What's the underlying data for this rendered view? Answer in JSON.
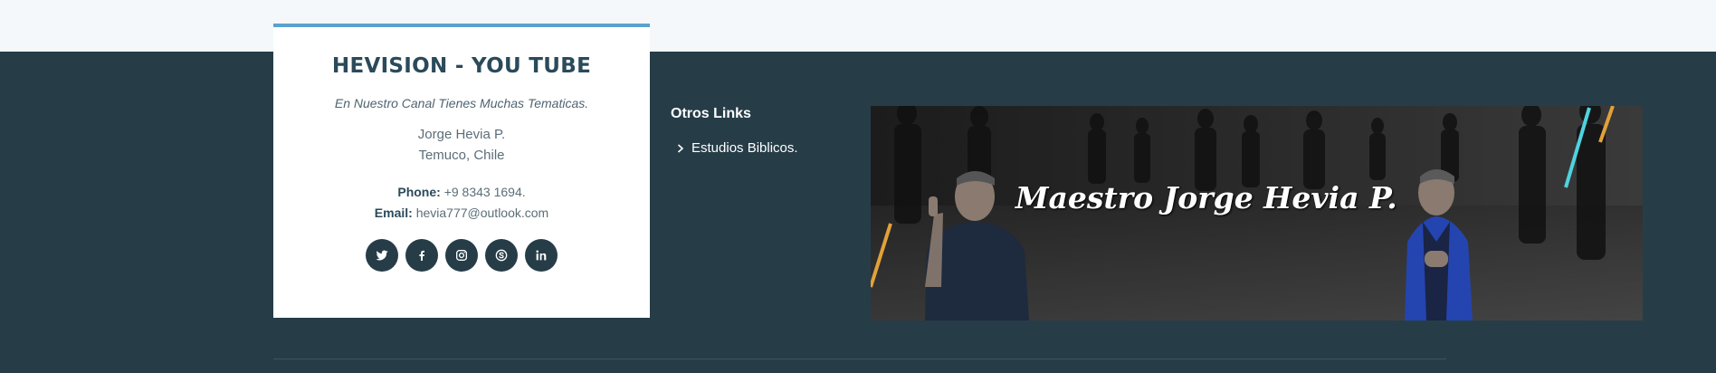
{
  "card": {
    "title": "HEVISION - YOU TUBE",
    "subtitle": "En Nuestro Canal Tienes Muchas Tematicas.",
    "name": "Jorge Hevia P.",
    "city": "Temuco, Chile",
    "phone_label": "Phone:",
    "phone_value": "+9 8343 1694.",
    "email_label": "Email:",
    "email_value": "hevia777@outlook.com",
    "socials": [
      "twitter-icon",
      "facebook-icon",
      "instagram-icon",
      "skype-icon",
      "linkedin-icon"
    ]
  },
  "links": {
    "title": "Otros Links",
    "items": [
      {
        "label": "Estudios Biblicos."
      }
    ]
  },
  "banner": {
    "title": "Maestro Jorge Hevia P."
  },
  "colors": {
    "footer_bg": "#263d48",
    "accent_top": "#5aa2cf",
    "card_title": "#2b4a5a"
  }
}
